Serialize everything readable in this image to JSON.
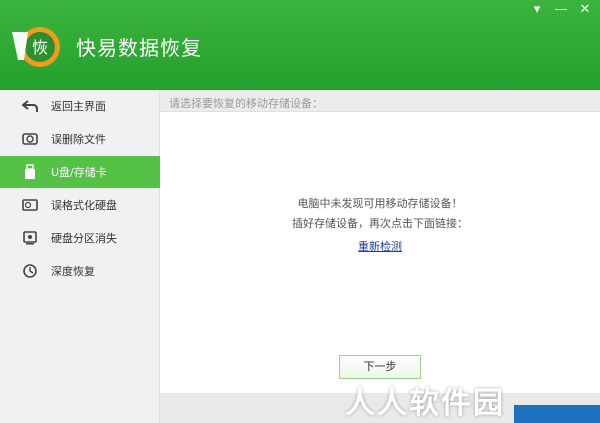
{
  "app": {
    "title": "快易数据恢复",
    "logo_text": "恢"
  },
  "window_controls": [
    {
      "name": "help-icon",
      "glyph": "▾"
    },
    {
      "name": "minimize-icon",
      "glyph": "—"
    },
    {
      "name": "close-icon",
      "glyph": "✕"
    }
  ],
  "sidebar": {
    "items": [
      {
        "label": "返回主界面",
        "icon": "back-arrow-icon"
      },
      {
        "label": "误删除文件",
        "icon": "recycle-bin-icon"
      },
      {
        "label": "U盘/存储卡",
        "icon": "usb-drive-icon",
        "active": true
      },
      {
        "label": "误格式化硬盘",
        "icon": "hard-disk-icon"
      },
      {
        "label": "硬盘分区消失",
        "icon": "partition-icon"
      },
      {
        "label": "深度恢复",
        "icon": "deep-recovery-icon"
      }
    ]
  },
  "main": {
    "header": "请选择要恢复的移动存储设备：",
    "message_line1": "电脑中未发现可用移动存储设备！",
    "message_line2": "插好存储设备，再次点击下面链接：",
    "redetect_link": "重新检测",
    "next_button": "下一步"
  },
  "watermark": "人人软件园",
  "colors": {
    "titlebar": "#2eac34",
    "active_nav": "#55c147",
    "sidebar_bg": "#f1f1f1",
    "link": "#1c3ea8"
  }
}
